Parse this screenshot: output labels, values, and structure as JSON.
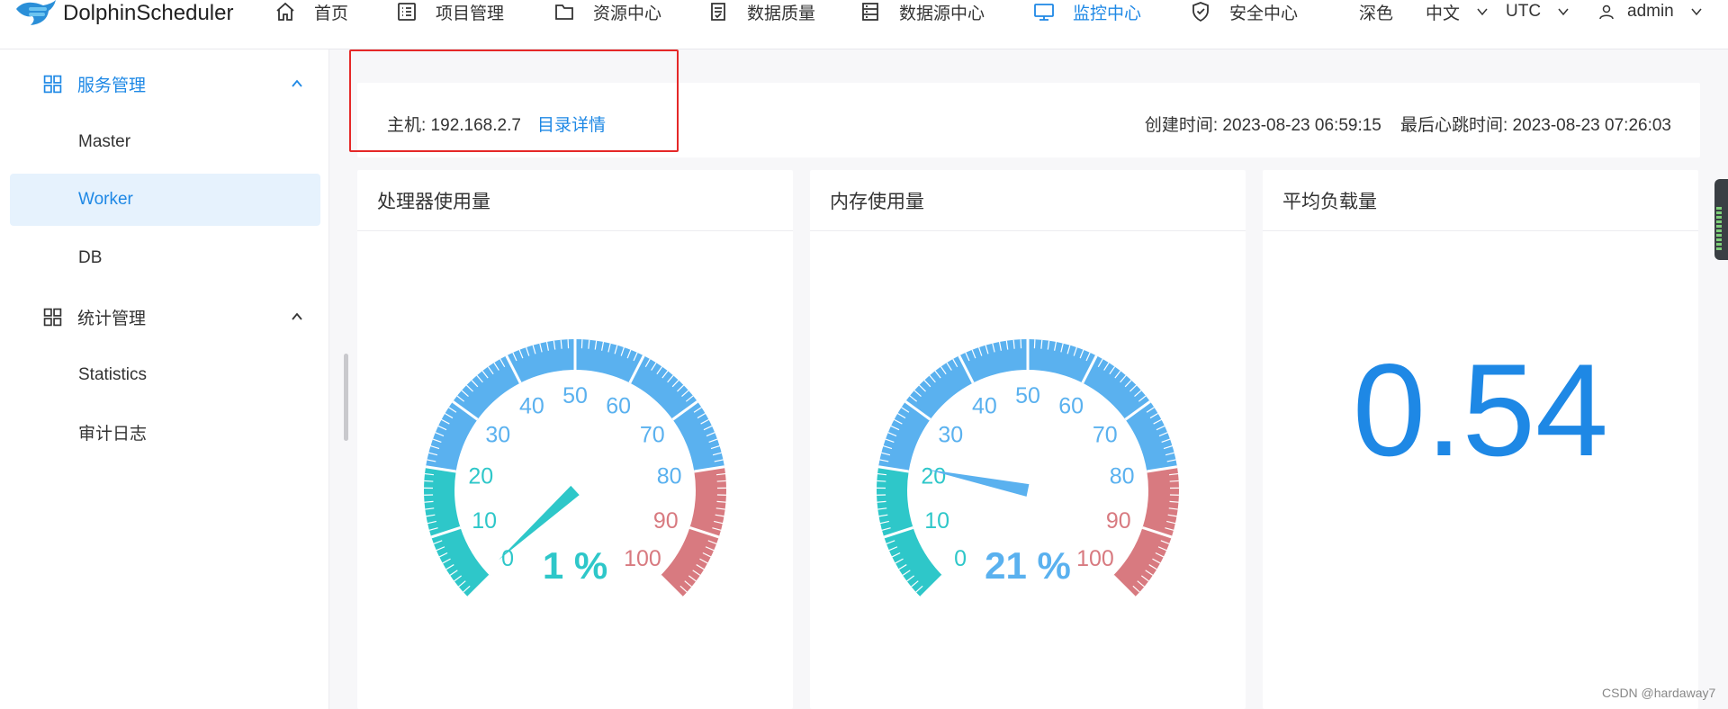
{
  "app": {
    "name": "DolphinScheduler"
  },
  "nav": {
    "items": [
      {
        "label": "首页",
        "icon": "home-icon"
      },
      {
        "label": "项目管理",
        "icon": "project-list-icon"
      },
      {
        "label": "资源中心",
        "icon": "folder-icon"
      },
      {
        "label": "数据质量",
        "icon": "data-quality-icon"
      },
      {
        "label": "数据源中心",
        "icon": "datasource-icon"
      },
      {
        "label": "监控中心",
        "icon": "monitor-icon",
        "active": true
      },
      {
        "label": "安全中心",
        "icon": "shield-icon"
      }
    ],
    "theme_label": "深色",
    "language": "中文",
    "timezone": "UTC",
    "user": "admin",
    "active_color": "#1e88e5"
  },
  "sidebar": {
    "groups": [
      {
        "label": "服务管理",
        "expanded": true,
        "items": [
          "Master",
          "Worker",
          "DB"
        ]
      },
      {
        "label": "统计管理",
        "expanded": true,
        "items": [
          "Statistics",
          "审计日志"
        ]
      }
    ],
    "active_item": "Worker"
  },
  "host": {
    "label": "主机: 192.168.2.7",
    "link": "目录详情",
    "created": "创建时间: 2023-08-23 06:59:15",
    "heartbeat": "最后心跳时间: 2023-08-23 07:26:03"
  },
  "panels": {
    "cpu": {
      "title": "处理器使用量",
      "value": 1,
      "display": "1 %"
    },
    "memory": {
      "title": "内存使用量",
      "value": 21,
      "display": "21 %"
    },
    "load": {
      "title": "平均负载量",
      "value": "0.54"
    }
  },
  "gauge": {
    "ticks": [
      "0",
      "10",
      "20",
      "30",
      "40",
      "50",
      "60",
      "70",
      "80",
      "90",
      "100"
    ],
    "colors": {
      "low": "#2ec7c9",
      "mid": "#5ab1ef",
      "high": "#d87a80"
    }
  },
  "watermark": "CSDN @hardaway7"
}
